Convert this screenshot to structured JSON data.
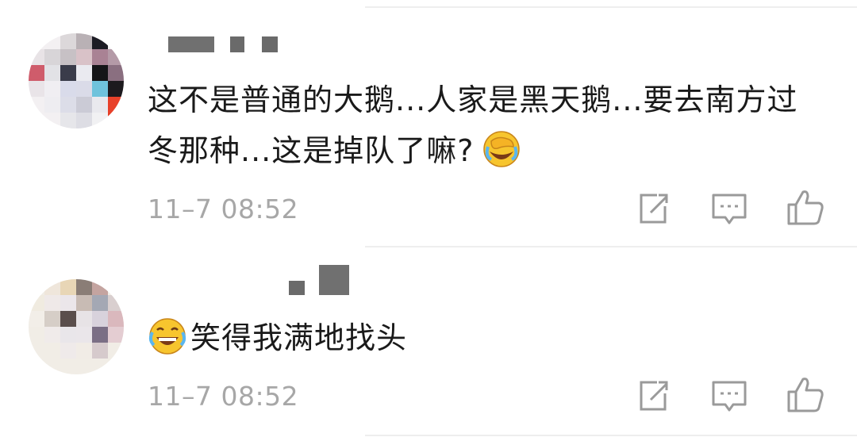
{
  "comments": [
    {
      "text": "这不是普通的大鹅...人家是黑天鹅...要去南方过冬那种...这是掉队了嘛?",
      "emoji": "cover-face-laugh-emoji",
      "emoji_position": "end",
      "timestamp": "11–7 08:52",
      "actions": [
        "share-icon",
        "reply-icon",
        "like-icon"
      ]
    },
    {
      "text": "笑得我满地找头",
      "emoji": "tears-of-joy-emoji",
      "emoji_position": "start",
      "timestamp": "11–7 08:52",
      "actions": [
        "share-icon",
        "reply-icon",
        "like-icon"
      ]
    }
  ],
  "colors": {
    "text": "#1a1a1a",
    "meta": "#a7a7a7",
    "icon": "#9a9a9a",
    "emoji_face": "#f7c52e",
    "divider": "#eeeeee"
  }
}
